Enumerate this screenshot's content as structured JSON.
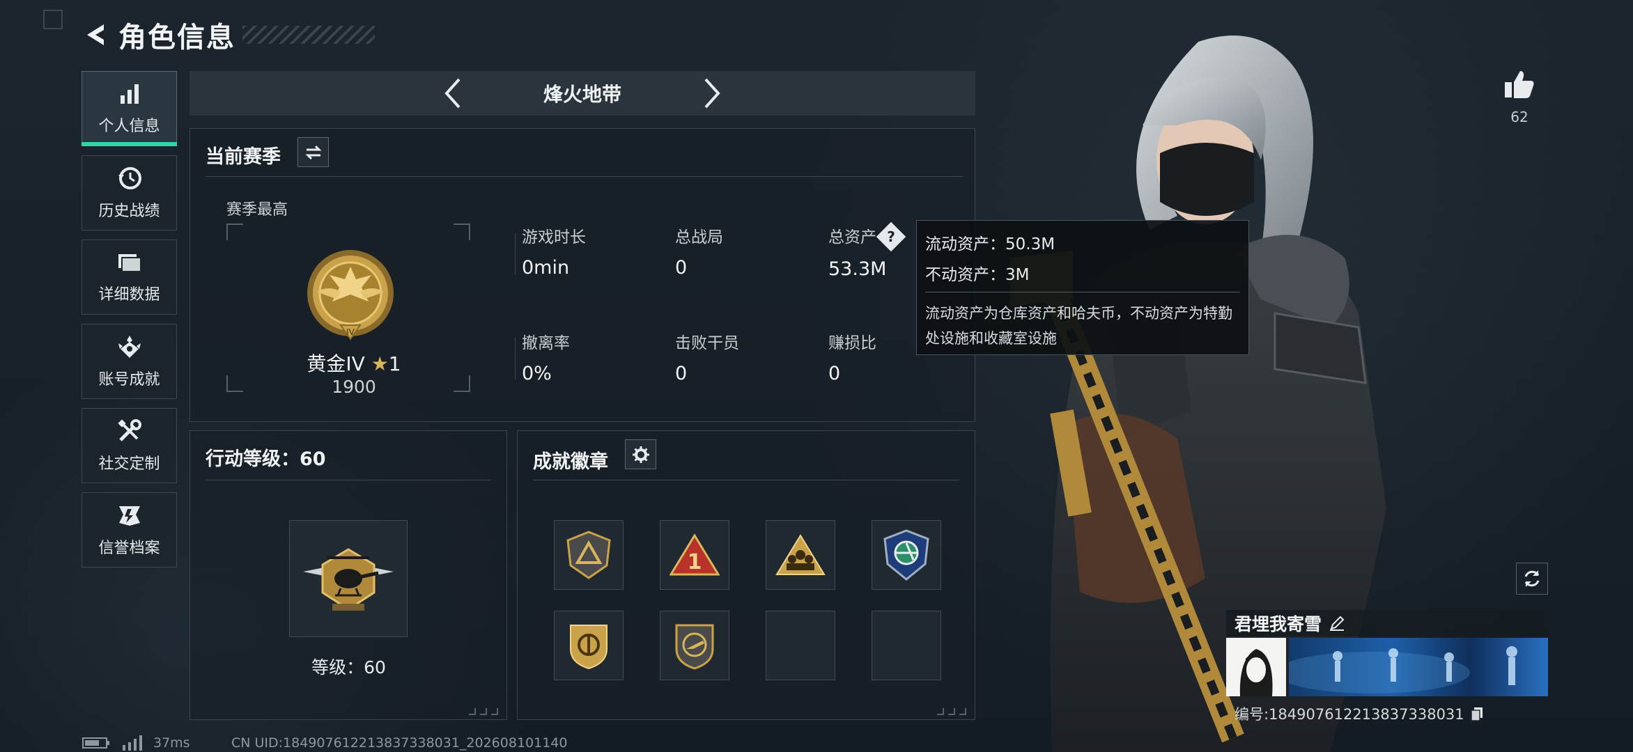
{
  "header": {
    "title": "角色信息"
  },
  "sidebar": {
    "items": [
      {
        "label": "个人信息",
        "icon": "bar-chart-icon",
        "active": true
      },
      {
        "label": "历史战绩",
        "icon": "history-clock-icon"
      },
      {
        "label": "详细数据",
        "icon": "folder-icon"
      },
      {
        "label": "账号成就",
        "icon": "achievement-icon"
      },
      {
        "label": "社交定制",
        "icon": "tools-icon"
      },
      {
        "label": "信誉档案",
        "icon": "reputation-icon"
      }
    ]
  },
  "mode_selector": {
    "title": "烽火地带"
  },
  "season": {
    "title": "当前赛季",
    "best_label": "赛季最高",
    "rank": {
      "name": "黄金IV",
      "stars": "1",
      "score": "1900"
    },
    "stats": [
      {
        "label": "游戏时长",
        "value": "0min"
      },
      {
        "label": "总战局",
        "value": "0"
      },
      {
        "label": "总资产",
        "value": "53.3M"
      },
      {
        "label": "撤离率",
        "value": "0%"
      },
      {
        "label": "击败干员",
        "value": "0"
      },
      {
        "label": "赚损比",
        "value": "0"
      }
    ]
  },
  "tooltip": {
    "liquid": "流动资产：50.3M",
    "fixed": "不动资产：3M",
    "description": "流动资产为仓库资产和哈夫币，不动资产为特勤处设施和收藏室设施"
  },
  "action_level": {
    "title": "行动等级：60",
    "level_label": "等级：60"
  },
  "badges": {
    "title": "成就徽章"
  },
  "likes": {
    "count": "62"
  },
  "profile": {
    "name": "君埋我寄雪",
    "id_label": "编号:18490761221383733803​1"
  },
  "status_bar": {
    "ping": "37ms",
    "uid": "CN UID:184907612213837338031_202608101140"
  },
  "colors": {
    "accent": "#2fd6a3",
    "gold": "#c9a24a",
    "panel_border": "#39454e"
  }
}
